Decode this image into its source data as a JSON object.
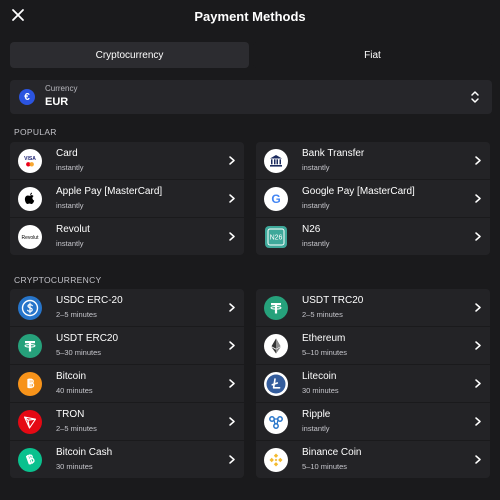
{
  "header": {
    "title": "Payment Methods"
  },
  "tabs": {
    "crypto": "Cryptocurrency",
    "fiat": "Fiat"
  },
  "currency": {
    "label": "Currency",
    "value": "EUR",
    "symbol": "€"
  },
  "sections": {
    "popular": "POPULAR",
    "crypto": "CRYPTOCURRENCY"
  },
  "popular_left": [
    {
      "name": "Card",
      "sub": "instantly",
      "icon": "visa-mastercard-icon"
    },
    {
      "name": "Apple Pay [MasterCard]",
      "sub": "instantly",
      "icon": "apple-icon"
    },
    {
      "name": "Revolut",
      "sub": "instantly",
      "icon": "revolut-icon"
    }
  ],
  "popular_right": [
    {
      "name": "Bank Transfer",
      "sub": "instantly",
      "icon": "bank-icon"
    },
    {
      "name": "Google Pay [MasterCard]",
      "sub": "instantly",
      "icon": "google-icon"
    },
    {
      "name": "N26",
      "sub": "instantly",
      "icon": "n26-icon"
    }
  ],
  "crypto_left": [
    {
      "name": "USDC ERC-20",
      "sub": "2–5 minutes",
      "icon": "usdc-icon"
    },
    {
      "name": "USDT ERC20",
      "sub": "5–30 minutes",
      "icon": "usdt-icon"
    },
    {
      "name": "Bitcoin",
      "sub": "40 minutes",
      "icon": "bitcoin-icon"
    },
    {
      "name": "TRON",
      "sub": "2–5 minutes",
      "icon": "tron-icon"
    },
    {
      "name": "Bitcoin Cash",
      "sub": "30 minutes",
      "icon": "bitcoin-cash-icon"
    }
  ],
  "crypto_right": [
    {
      "name": "USDT TRC20",
      "sub": "2–5 minutes",
      "icon": "usdt-icon"
    },
    {
      "name": "Ethereum",
      "sub": "5–10 minutes",
      "icon": "ethereum-icon"
    },
    {
      "name": "Litecoin",
      "sub": "30 minutes",
      "icon": "litecoin-icon"
    },
    {
      "name": "Ripple",
      "sub": "instantly",
      "icon": "ripple-icon"
    },
    {
      "name": "Binance Coin",
      "sub": "5–10 minutes",
      "icon": "binance-icon"
    }
  ],
  "icon_text": {
    "visa": "VISA",
    "revolut": "Revolut",
    "n26": "N26",
    "google": "G"
  },
  "colors": {
    "background": "#1a1a1c",
    "panel": "#232326",
    "euro": "#2b54e0",
    "usdc": "#2775ca",
    "usdt": "#26a17b",
    "bitcoin": "#f7931a",
    "tron": "#e50914",
    "bitcoin_cash": "#0ac18e",
    "litecoin": "#345d9d",
    "ripple": "#23292f",
    "binance": "#f3ba2f"
  }
}
